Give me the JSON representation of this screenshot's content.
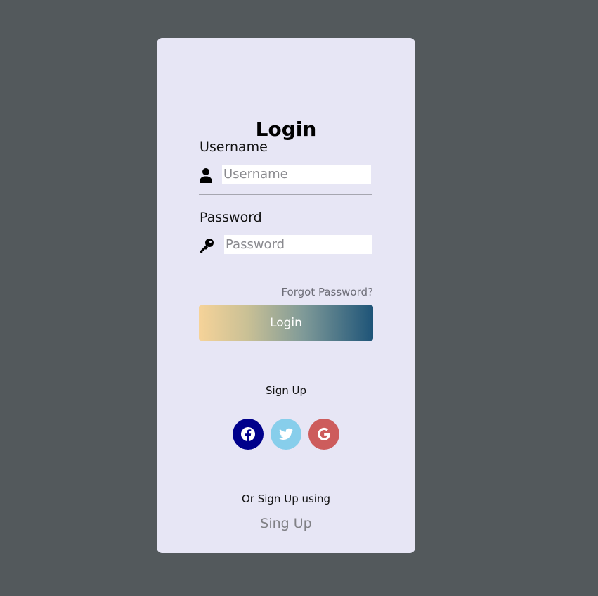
{
  "form": {
    "title": "Login",
    "username": {
      "label": "Username",
      "placeholder": "Username",
      "icon": "user-icon"
    },
    "password": {
      "label": "Password",
      "placeholder": "Password",
      "icon": "key-icon"
    },
    "forgot_password": "Forgot Password?",
    "login_button": "Login"
  },
  "signup": {
    "heading": "Sign Up",
    "social_buttons": [
      {
        "name": "facebook",
        "icon": "facebook-icon",
        "color": "#00008b"
      },
      {
        "name": "twitter",
        "icon": "twitter-icon",
        "color": "#87ceeb"
      },
      {
        "name": "google",
        "icon": "google-icon",
        "color": "#cd5c5c"
      }
    ],
    "alt_text": "Or Sign Up using",
    "alt_link": "Sing Up"
  },
  "colors": {
    "page_background": "#53595c",
    "card_background": "#e7e6f5",
    "button_gradient": [
      "#f6d399",
      "#1e5478"
    ]
  }
}
